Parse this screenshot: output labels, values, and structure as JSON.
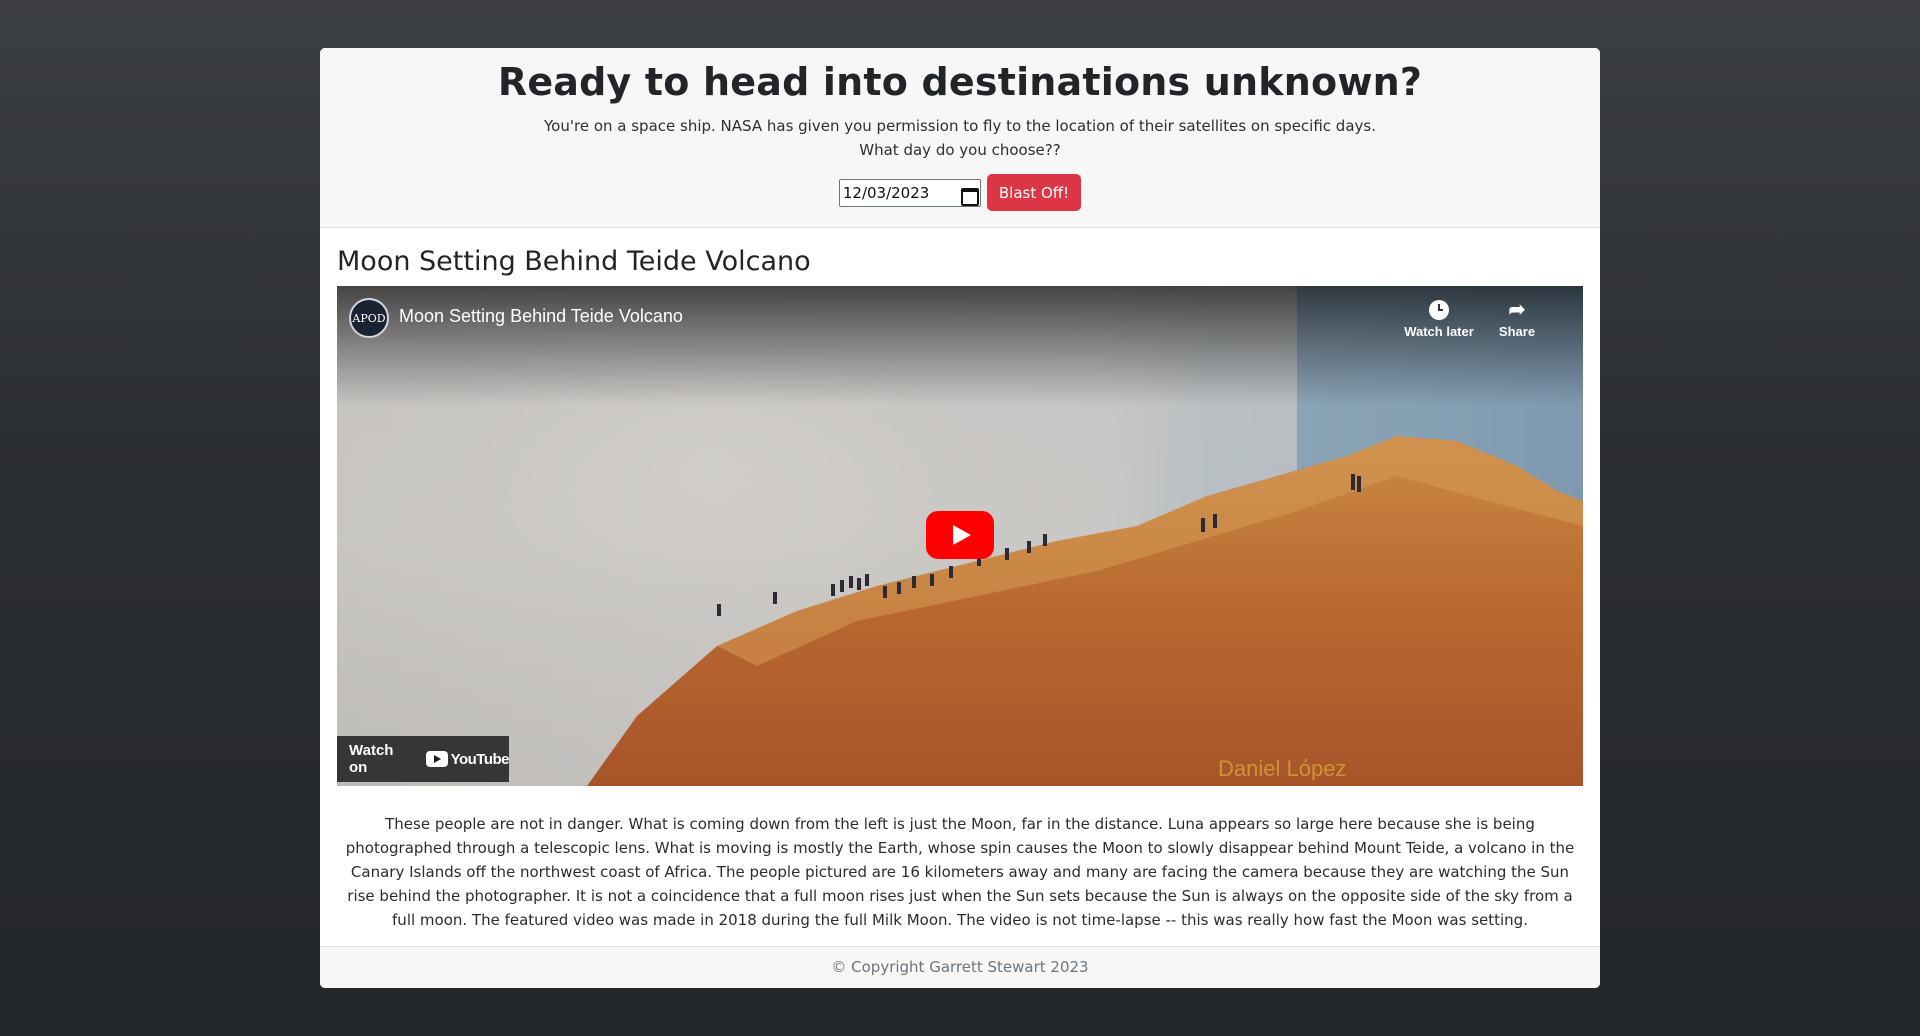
{
  "header": {
    "title": "Ready to head into destinations unknown?",
    "line1": "You're on a space ship. NASA has given you permission to fly to the location of their satellites on specific days.",
    "line2": "What day do you choose??",
    "date_value": "12/03/2023",
    "button_label": "Blast Off!"
  },
  "apod": {
    "title": "Moon Setting Behind Teide Volcano",
    "explanation": "These people are not in danger. What is coming down from the left is just the Moon, far in the distance. Luna appears so large here because she is being photographed through a telescopic lens. What is moving is mostly the Earth, whose spin causes the Moon to slowly disappear behind Mount Teide, a volcano in the Canary Islands off the northwest coast of Africa. The people pictured are 16 kilometers away and many are facing the camera because they are watching the Sun rise behind the photographer. It is not a coincidence that a full moon rises just when the Sun sets because the Sun is always on the opposite side of the sky from a full moon. The featured video was made in 2018 during the full Milk Moon. The video is not time-lapse -- this was really how fast the Moon was setting."
  },
  "video": {
    "channel_logo_text": "APOD",
    "title": "Moon Setting Behind Teide Volcano",
    "watch_later": "Watch later",
    "share": "Share",
    "watch_on": "Watch on",
    "youtube": "YouTube",
    "watermark": "Daniel López"
  },
  "footer": {
    "copyright": "© Copyright Garrett Stewart 2023"
  },
  "colors": {
    "button_red": "#dc3545",
    "play_red": "#ff0000",
    "background_dark": "#2b2e31"
  }
}
